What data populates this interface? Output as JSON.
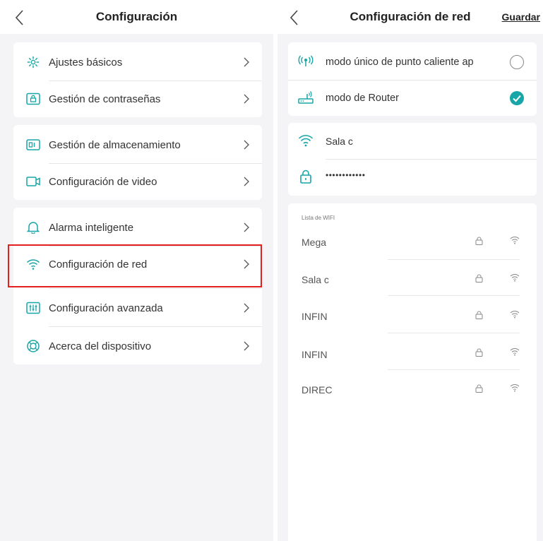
{
  "colors": {
    "accent": "#17a6a8",
    "highlight": "#e32020",
    "background": "#f4f4f6"
  },
  "left": {
    "title": "Configuración",
    "groups": [
      {
        "items": [
          {
            "label": "Ajustes básicos",
            "icon": "gear-icon"
          },
          {
            "label": "Gestión de contraseñas",
            "icon": "lock-icon"
          }
        ]
      },
      {
        "items": [
          {
            "label": "Gestión de almacenamiento",
            "icon": "storage-icon"
          },
          {
            "label": "Configuración de video",
            "icon": "video-camera-icon"
          }
        ]
      },
      {
        "items": [
          {
            "label": "Alarma inteligente",
            "icon": "bell-icon"
          },
          {
            "label": "Configuración de red",
            "icon": "wifi-icon",
            "highlighted": true
          },
          {
            "label": "Configuración avanzada",
            "icon": "sliders-icon"
          },
          {
            "label": "Acerca del dispositivo",
            "icon": "info-ring-icon"
          }
        ]
      }
    ]
  },
  "right": {
    "title": "Configuración de red",
    "save_label": "Guardar",
    "modes": [
      {
        "label": "modo único de punto caliente ap",
        "icon": "hotspot-icon",
        "selected": false
      },
      {
        "label": "modo de Router",
        "icon": "router-icon",
        "selected": true
      }
    ],
    "ssid_value": "Sala c",
    "password_value": "••••••••••••",
    "wifi_list_header": "Lista de WIFI",
    "wifi_list": [
      {
        "name": "Mega"
      },
      {
        "name": "Sala c"
      },
      {
        "name": "INFIN"
      },
      {
        "name": "INFIN"
      },
      {
        "name": "DIREC"
      }
    ]
  }
}
